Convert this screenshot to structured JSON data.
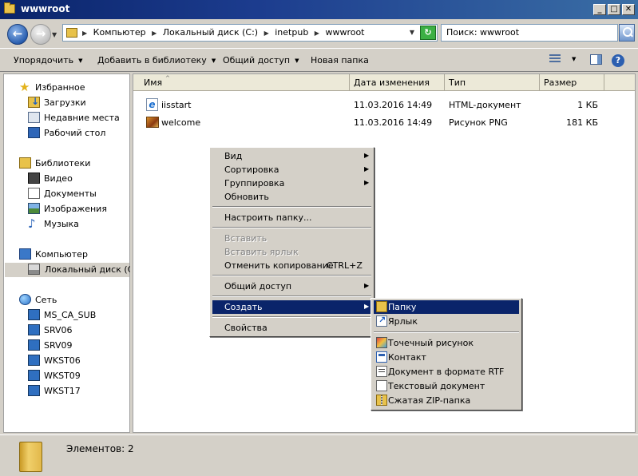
{
  "window": {
    "title": "wwwroot",
    "btn_minimize": "_",
    "btn_maximize": "□",
    "btn_close": "✕"
  },
  "address_bar": {
    "crumbs": [
      "Компьютер",
      "Локальный диск (C:)",
      "inetpub",
      "wwwroot"
    ],
    "back_glyph": "←",
    "forward_glyph": "→",
    "refresh_glyph": "↻"
  },
  "search": {
    "text": "Поиск: wwwroot"
  },
  "toolbar": {
    "organize": "Упорядочить",
    "add_to_library": "Добавить в библиотеку",
    "share": "Общий доступ",
    "new_folder": "Новая папка",
    "help_glyph": "?"
  },
  "nav": {
    "favorites": {
      "label": "Избранное",
      "items": [
        "Загрузки",
        "Недавние места",
        "Рабочий стол"
      ]
    },
    "libraries": {
      "label": "Библиотеки",
      "items": [
        "Видео",
        "Документы",
        "Изображения",
        "Музыка"
      ]
    },
    "computer": {
      "label": "Компьютер",
      "items": [
        "Локальный диск (C:)"
      ]
    },
    "network": {
      "label": "Сеть",
      "items": [
        "MS_CA_SUB",
        "SRV06",
        "SRV09",
        "WKST06",
        "WKST09",
        "WKST17"
      ]
    },
    "selected": "Локальный диск (C:)"
  },
  "files": {
    "columns": [
      "Имя",
      "Дата изменения",
      "Тип",
      "Размер"
    ],
    "sort_indicator": "^",
    "rows": [
      {
        "name": "iisstart",
        "date": "11.03.2016 14:49",
        "type": "HTML-документ",
        "size": "1 КБ",
        "icon": "ie-html-icon"
      },
      {
        "name": "welcome",
        "date": "11.03.2016 14:49",
        "type": "Рисунок PNG",
        "size": "181 КБ",
        "icon": "png-image-icon"
      }
    ]
  },
  "context_menu": {
    "view": "Вид",
    "sort": "Сортировка",
    "group": "Группировка",
    "refresh": "Обновить",
    "customize": "Настроить папку...",
    "paste": "Вставить",
    "paste_shortcut": "Вставить ярлык",
    "undo_copy": "Отменить копирование",
    "undo_copy_shortcut": "CTRL+Z",
    "share": "Общий доступ",
    "create": "Создать",
    "properties": "Свойства",
    "submenu_arrow": "▶"
  },
  "create_submenu": {
    "items": [
      "Папку",
      "Ярлык",
      "Точечный рисунок",
      "Контакт",
      "Документ в формате RTF",
      "Текстовый документ",
      "Сжатая ZIP-папка"
    ],
    "highlighted": "Папку"
  },
  "status": {
    "text": "Элементов: 2"
  },
  "colors": {
    "titlebar": "#0a246a",
    "highlight": "#0a246a",
    "face": "#d4d0c8"
  }
}
